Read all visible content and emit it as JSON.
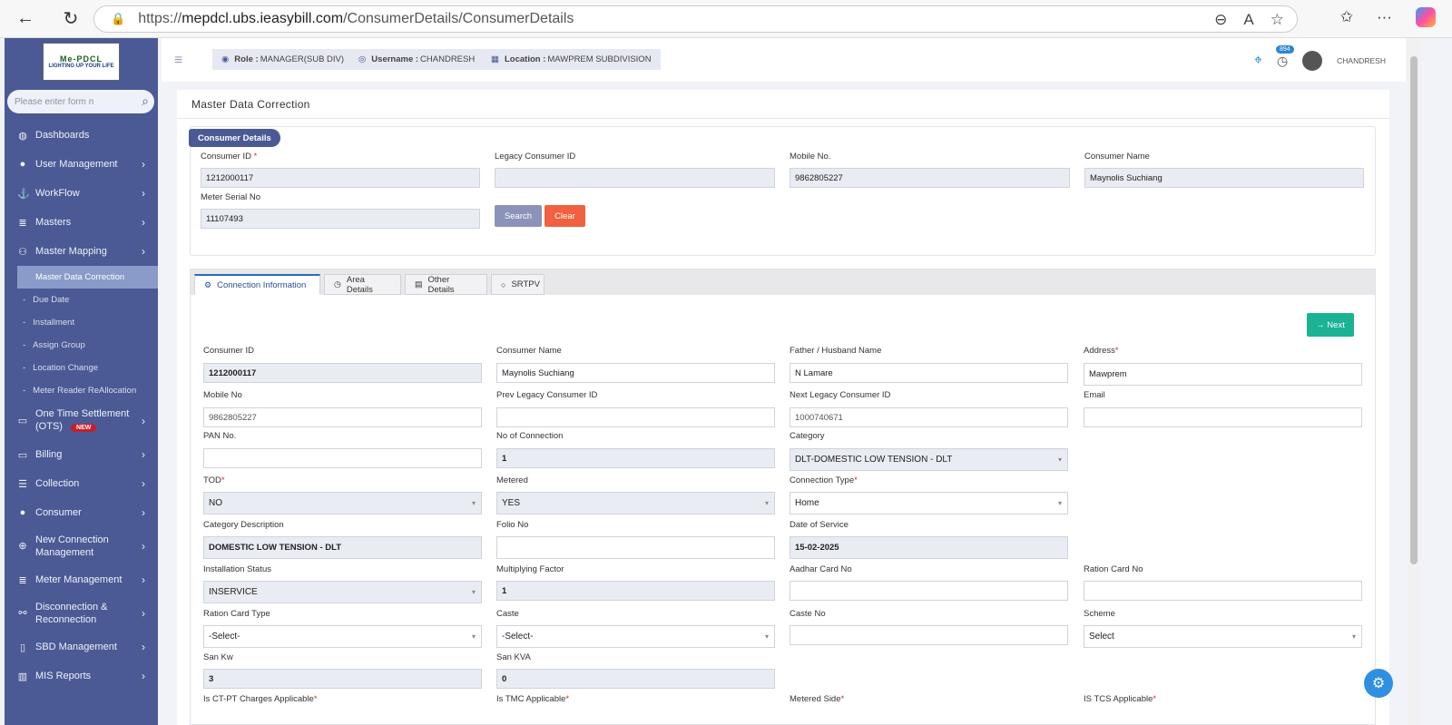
{
  "browser": {
    "url_prefix": "https://",
    "url_host": "mepdcl.ubs.ieasybill.com",
    "url_path": "/ConsumerDetails/ConsumerDetails"
  },
  "sidebar": {
    "logo_brand": "Me-PDCL",
    "logo_tagline": "LIGHTING UP YOUR LIFE",
    "search_placeholder": "Please enter form n",
    "items": [
      {
        "label": "Dashboards",
        "icon": "dashboard-icon"
      },
      {
        "label": "User Management",
        "icon": "user-icon"
      },
      {
        "label": "WorkFlow",
        "icon": "anchor-icon"
      },
      {
        "label": "Masters",
        "icon": "list-icon"
      },
      {
        "label": "Master Mapping",
        "icon": "sitemap-icon"
      }
    ],
    "sub_items": [
      "Master Data Correction",
      "Due Date",
      "Installment",
      "Assign Group",
      "Location Change",
      "Meter Reader ReAllocation"
    ],
    "items2": [
      {
        "label": "One Time Settlement (OTS)",
        "icon": "monitor-icon",
        "badge": "NEW"
      },
      {
        "label": "Billing",
        "icon": "monitor-icon"
      },
      {
        "label": "Collection",
        "icon": "list-icon"
      },
      {
        "label": "Consumer",
        "icon": "user-icon"
      },
      {
        "label": "New Connection Management",
        "icon": "plus-circle-icon"
      },
      {
        "label": "Meter Management",
        "icon": "list-icon"
      },
      {
        "label": "Disconnection & Reconnection",
        "icon": "link-icon"
      },
      {
        "label": "SBD Management",
        "icon": "phone-icon"
      },
      {
        "label": "MIS Reports",
        "icon": "bar-chart-icon"
      }
    ]
  },
  "topbar": {
    "role_label": "Role :",
    "role_value": "MANAGER(SUB DIV)",
    "username_label": "Username :",
    "username_value": "CHANDRESH",
    "location_label": "Location :",
    "location_value": "MAWPREM SUBDIVISION",
    "notif_count": "894",
    "user_name": "CHANDRESH"
  },
  "page": {
    "title": "Master Data Correction"
  },
  "consumer_details": {
    "tag": "Consumer Details",
    "consumer_id_label": "Consumer ID",
    "consumer_id_value": "1212000117",
    "legacy_id_label": "Legacy Consumer ID",
    "legacy_id_value": "",
    "mobile_label": "Mobile No.",
    "mobile_value": "9862805227",
    "name_label": "Consumer Name",
    "name_value": "Maynolis Suchiang",
    "meter_label": "Meter Serial No",
    "meter_value": "11107493",
    "search_btn": "Search",
    "clear_btn": "Clear"
  },
  "tabs": [
    "Connection Information",
    "Area Details",
    "Other Details",
    "SRTPV"
  ],
  "next_btn": "→ Next",
  "form": {
    "consumer_id": {
      "label": "Consumer ID",
      "value": "1212000117"
    },
    "consumer_name": {
      "label": "Consumer Name",
      "value": "Maynolis Suchiang"
    },
    "father_name": {
      "label": "Father / Husband Name",
      "value": "N Lamare"
    },
    "address": {
      "label": "Address",
      "value": "Mawprem"
    },
    "mobile": {
      "label": "Mobile No",
      "value": "9862805227"
    },
    "prev_legacy": {
      "label": "Prev Legacy Consumer ID",
      "value": ""
    },
    "next_legacy": {
      "label": "Next Legacy Consumer ID",
      "value": "1000740671"
    },
    "email": {
      "label": "Email",
      "value": ""
    },
    "pan": {
      "label": "PAN No.",
      "value": ""
    },
    "no_conn": {
      "label": "No of Connection",
      "value": "1"
    },
    "category": {
      "label": "Category",
      "value": "DLT-DOMESTIC LOW TENSION - DLT"
    },
    "tod": {
      "label": "TOD",
      "value": "NO"
    },
    "metered": {
      "label": "Metered",
      "value": "YES"
    },
    "conn_type": {
      "label": "Connection Type",
      "value": "Home"
    },
    "cat_desc": {
      "label": "Category Description",
      "value": "DOMESTIC LOW TENSION - DLT"
    },
    "folio": {
      "label": "Folio No",
      "value": ""
    },
    "date_service": {
      "label": "Date of Service",
      "value": "15-02-2025"
    },
    "inst_status": {
      "label": "Installation Status",
      "value": "INSERVICE"
    },
    "mult_factor": {
      "label": "Multiplying Factor",
      "value": "1"
    },
    "aadhar": {
      "label": "Aadhar Card No",
      "value": ""
    },
    "ration": {
      "label": "Ration Card No",
      "value": ""
    },
    "ration_type": {
      "label": "Ration Card Type",
      "value": "-Select-"
    },
    "caste": {
      "label": "Caste",
      "value": "-Select-"
    },
    "caste_no": {
      "label": "Caste No",
      "value": ""
    },
    "scheme": {
      "label": "Scheme",
      "value": "Select"
    },
    "san_kw": {
      "label": "San Kw",
      "value": "3"
    },
    "san_kva": {
      "label": "San KVA",
      "value": "0"
    },
    "ctpt": {
      "label": "Is CT-PT Charges Applicable"
    },
    "tmc": {
      "label": "Is TMC Applicable"
    },
    "metered_side": {
      "label": "Metered Side"
    },
    "tcs": {
      "label": "IS TCS Applicable"
    }
  }
}
